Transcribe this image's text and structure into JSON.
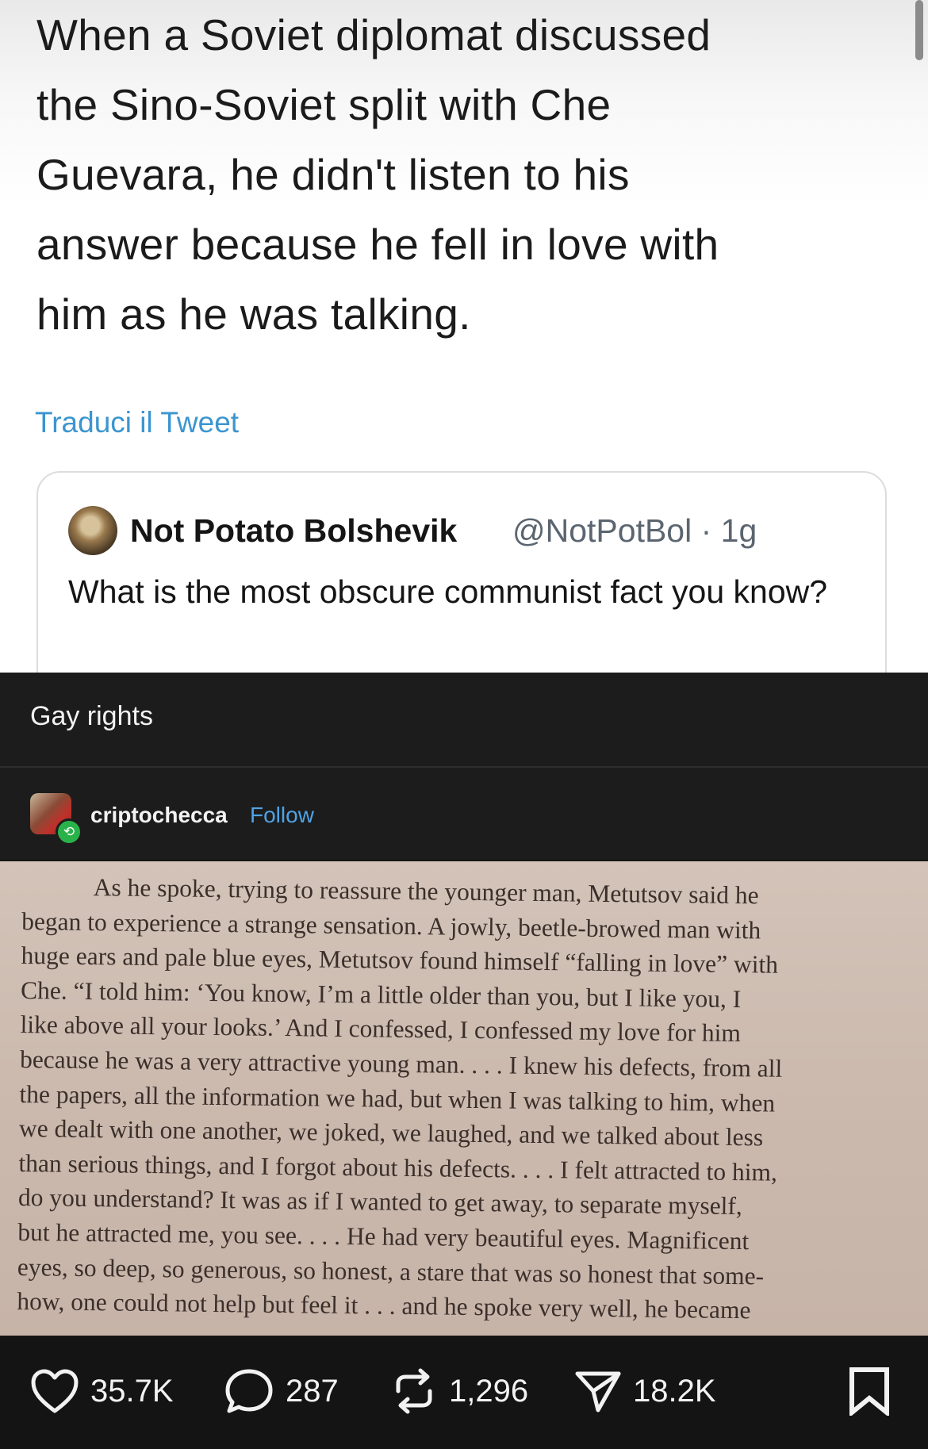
{
  "tweet": {
    "text_lines": [
      "When a Soviet diplomat discussed",
      "the Sino-Soviet split with Che",
      "Guevara, he didn't listen to his",
      "answer because he fell in love with",
      "him as he was talking."
    ],
    "translate_link": "Traduci il Tweet",
    "quoted": {
      "name": "Not Potato Bolshevik",
      "handle_time": "@NotPotBol · 1g",
      "text": "What is the most obscure communist fact you know?"
    }
  },
  "post": {
    "caption": "Gay rights",
    "username": "criptochecca",
    "follow_label": "Follow",
    "book_lines": [
      "As he spoke, trying to reassure the younger man, Metutsov said he",
      "began to experience a strange sensation. A jowly, beetle-browed man with",
      "huge ears and pale blue eyes, Metutsov found himself “falling in love” with",
      "Che. “I told him: ‘You know, I’m a little older than you, but I like you, I",
      "like above all your looks.’ And I confessed, I confessed my love for him",
      "because he was a very attractive young man. . . . I knew his defects, from all",
      "the papers, all the information we had, but when I was talking to him, when",
      "we dealt with one another, we joked, we laughed, and we talked about less",
      "than serious things, and I forgot about his defects. . . . I felt attracted to him,",
      "do you understand? It was as if I wanted to get away, to separate myself,",
      "but he attracted me, you see. . . . He had very beautiful eyes. Magnificent",
      "eyes, so deep, so generous, so honest, a stare that was so honest that some-",
      "how, one could not help but feel it . . . and he spoke very well, he became"
    ]
  },
  "actions": {
    "likes": "35.7K",
    "comments": "287",
    "reposts": "1,296",
    "shares": "18.2K"
  },
  "icons": [
    "heart-icon",
    "comment-icon",
    "repost-icon",
    "share-icon",
    "bookmark-icon"
  ]
}
